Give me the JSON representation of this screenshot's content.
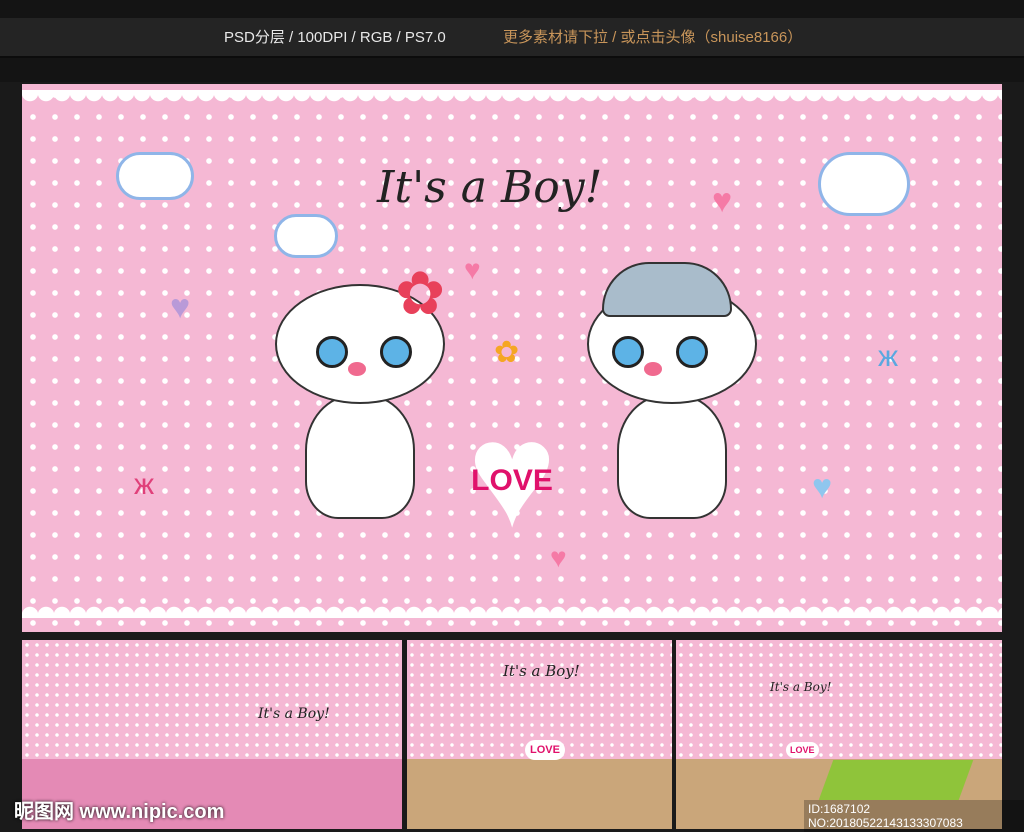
{
  "header": {
    "spec": "PSD分层 / 100DPI / RGB / PS7.0",
    "more": "更多素材请下拉 / 或点击头像（shuise8166）"
  },
  "main": {
    "title": "It's a Boy!",
    "love": "LOVE"
  },
  "thumbs": [
    {
      "title": "It's a Boy!"
    },
    {
      "title": "It's a Boy!",
      "love": "LOVE"
    },
    {
      "title": "It's a Boy!",
      "love": "LOVE"
    }
  ],
  "watermark": "昵图网 www.nipic.com",
  "id": "ID:1687102 NO:20180522143133307083",
  "colors": {
    "pink": "#f5b8d4",
    "accent": "#c8955a",
    "love": "#e0116b"
  }
}
